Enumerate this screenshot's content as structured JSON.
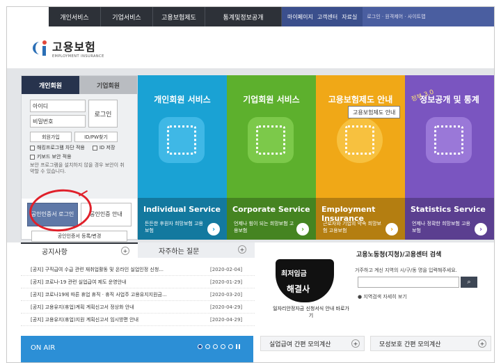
{
  "nav": {
    "menus": [
      "개인서비스",
      "기업서비스",
      "고용보험제도",
      "통계및정보공개"
    ],
    "util": [
      "마이페이지",
      "고객센터",
      "자료실"
    ],
    "login_links": "로그인 · 원격제어 · 사이트맵"
  },
  "logo": {
    "korean": "고용보험",
    "english": "EMPLOYMENT INSURANCE"
  },
  "login": {
    "tab_personal": "개인회원",
    "tab_business": "기업회원",
    "id_placeholder": "아이디",
    "pw_placeholder": "비밀번호",
    "login_button": "로그인",
    "signup": "회원가입",
    "find": "ID/PW찾기",
    "hacking_check": "해킹프로그램 차단 적용",
    "save_id": "ID 저장",
    "keyboard_check": "키보드 보안 적용",
    "notice": "보안 프로그램을 설치하지 않을 경우 보안이 취약할 수 있습니다.",
    "cert_login": "공인인증서 로그인",
    "cert_guide": "공인인증 안내",
    "cert_register": "공인인증서 등록/변경"
  },
  "tiles": [
    {
      "title": "개인회원 서비스",
      "en": "Individual Service",
      "sub": "든든한 후원자 희망보험 고용보험",
      "icon": "person-icon",
      "color": "#1aa2d4"
    },
    {
      "title": "기업회원 서비스",
      "en": "Corporate Service",
      "sub": "언제나 힘이 되는 희망보험 고용보험",
      "icon": "building-icon",
      "color": "#5db02d"
    },
    {
      "title": "고용보험제도 안내",
      "en": "Employment Insurance",
      "sub": "근로자와 기업의 약속 희망보험 고용보험",
      "icon": "document-icon",
      "color": "#f0a817"
    },
    {
      "title": "정보공개 및 통계",
      "en": "Statistics Service",
      "sub": "언제나 정확한 희망보험 고용보험",
      "icon": "bar-chart-icon",
      "color": "#7a55c0",
      "badge": "정부 3.0"
    }
  ],
  "tooltip": "고용보험제도 안내",
  "notices": {
    "tab_notice": "공지사항",
    "tab_faq": "자주하는 질문",
    "items": [
      {
        "title": "[공지] 구직급여 수급 관련 재취업활동 및 온라인 실업인정 신청...",
        "date": "[2020-02-04]"
      },
      {
        "title": "[공지] 코로나-19 관련 실업급여 제도 운영안내",
        "date": "[2020-01-29]"
      },
      {
        "title": "[공지] 코로나19에 따른 휴업 휴직 · 휴직 사업주 고용유지지원금...",
        "date": "[2020-03-20]"
      },
      {
        "title": "[공지] 고용유지(휴업)계획 계획신고서 정상화 안내",
        "date": "[2020-04-29]"
      },
      {
        "title": "[공지] 고용유지(휴업)지원 계획신고서 임시방편 안내",
        "date": "[2020-04-29]"
      }
    ]
  },
  "campaign": {
    "line1": "최저임금",
    "line2": "해결사",
    "caption": "일자리안정자금 신청서식 안내 바로가기"
  },
  "search": {
    "heading": "고용노동청(지청)/고용센터 검색",
    "desc": "거주하고 계신 지역의 시/구/동 명을 입력해주세요.",
    "map_link": "지역검색 자세히 보기"
  },
  "bottom": {
    "onair": "ON AIR",
    "calc1": "실업급여 간편 모의계산",
    "calc2": "모성보호 간편 모의계산"
  }
}
